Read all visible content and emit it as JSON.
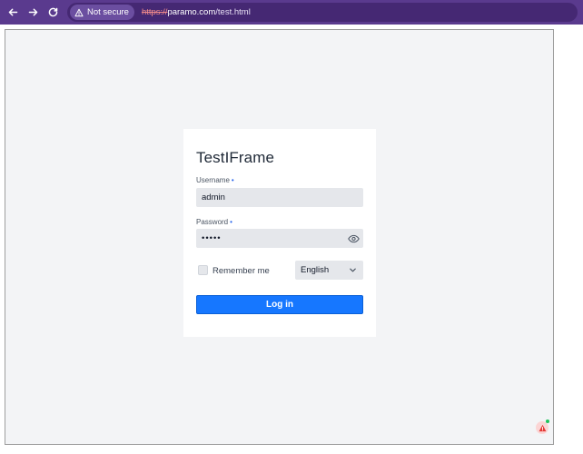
{
  "browser": {
    "security_label": "Not secure",
    "url_scheme": "https://",
    "url_host": "paramo.com",
    "url_path": "/test.html"
  },
  "login": {
    "title": "TestIFrame",
    "username_label": "Username",
    "username_value": "admin",
    "password_label": "Password",
    "password_value": "•••••",
    "required_mark": "•",
    "remember_label": "Remember me",
    "remember_checked": false,
    "language_selected": "English",
    "login_button": "Log in"
  },
  "colors": {
    "chrome_bg": "#5a3a8e",
    "page_bg": "#f3f4f6",
    "primary": "#1677ff",
    "required": "#2563eb"
  },
  "icons": {
    "back": "arrow-left-icon",
    "forward": "arrow-right-icon",
    "reload": "reload-icon",
    "warning": "warning-triangle-icon",
    "eye": "eye-icon",
    "chevron": "chevron-down-icon",
    "alert": "alert-icon"
  }
}
